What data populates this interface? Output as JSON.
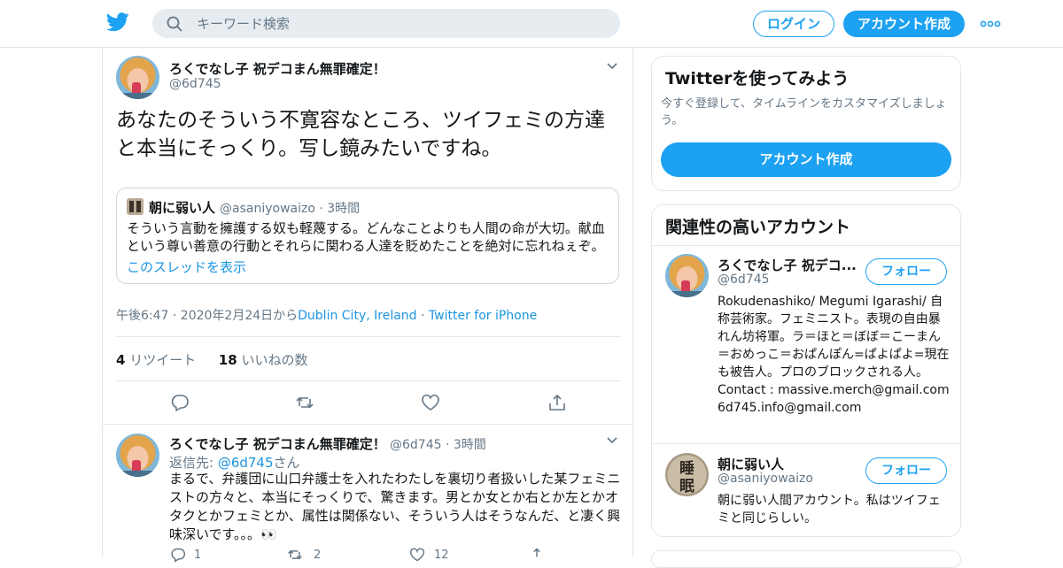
{
  "header": {
    "search_placeholder": "キーワード検索",
    "login_label": "ログイン",
    "signup_label": "アカウント作成",
    "brand_color": "#1da1f2"
  },
  "tweet": {
    "name": "ろくでなし子 祝デコまん無罪確定！",
    "handle": "@6d745",
    "text": "あなたのそういう不寛容なところ、ツイフェミの方達と本当にそっくり。写し鏡みたいですね。",
    "quote": {
      "name": "朝に弱い人",
      "handle": "@asaniyowaizo",
      "separator": "·",
      "time": "3時間",
      "text": "そういう言動を擁護する奴も軽蔑する。どんなことよりも人間の命が大切。献血という尊い善意の行動とそれらに関わる人達を貶めたことを絶対に忘れねぇぞ。",
      "thread_link": "このスレッドを表示"
    },
    "meta_time": "午後6:47 · 2020年2月24日から",
    "meta_location": "Dublin City, Ireland",
    "meta_sep": "·",
    "meta_source": "Twitter for iPhone",
    "retweets_count": "4",
    "retweets_label": "リツイート",
    "likes_count": "18",
    "likes_label": "いいねの数"
  },
  "reply": {
    "name": "ろくでなし子 祝デコまん無罪確定！",
    "handle": "@6d745",
    "separator": "·",
    "time": "3時間",
    "reply_prefix": "返信先: ",
    "reply_to": "@6d745",
    "reply_suffix": "さん",
    "text": "まるで、弁護団に山口弁護士を入れたわたしを裏切り者扱いした某フェミニストの方々と、本当にそっくりで、驚きます。男とか女とか右とか左とかオタクとかフェミとか、属性は関係ない、そういう人はそうなんだ、と凄く興味深いです。。。👀",
    "reply_count": "1",
    "retweet_count": "2",
    "like_count": "12"
  },
  "sidebar": {
    "try_card": {
      "title": "Twitterを使ってみよう",
      "subtitle": "今すぐ登録して、タイムラインをカスタマイズしましょう。",
      "button": "アカウント作成"
    },
    "related": {
      "title": "関連性の高いアカウント",
      "follow_label": "フォロー",
      "accounts": [
        {
          "name": "ろくでなし子 祝デコ...",
          "handle": "@6d745",
          "bio": "Rokudenashiko/ Megumi Igarashi/ 自称芸術家。フェミニスト。表現の自由暴れん坊将軍。ラ＝ほと＝ぼぼ＝こーまん＝おめっこ＝おぱんぽん=ぱよぱよ=現在も被告人。プロのブロックされる人。Contact : massive.merch@gmail.com 6d745.info@gmail.com"
        },
        {
          "name": "朝に弱い人",
          "handle": "@asaniyowaizo",
          "bio": "朝に弱い人間アカウント。私はツイフェミと同じらしい。"
        }
      ]
    }
  }
}
